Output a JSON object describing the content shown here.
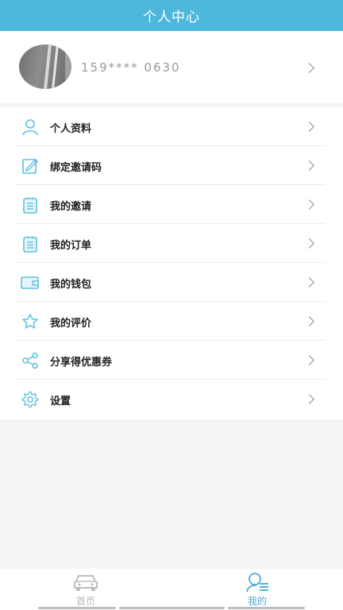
{
  "header": {
    "title": "个人中心"
  },
  "profile": {
    "phone": "159**** 0630"
  },
  "menu": {
    "items": [
      {
        "label": "个人资料",
        "icon": "user-icon"
      },
      {
        "label": "绑定邀请码",
        "icon": "edit-icon"
      },
      {
        "label": "我的邀请",
        "icon": "list-icon"
      },
      {
        "label": "我的订单",
        "icon": "list-icon"
      },
      {
        "label": "我的钱包",
        "icon": "wallet-icon"
      },
      {
        "label": "我的评价",
        "icon": "star-icon"
      },
      {
        "label": "分享得优惠券",
        "icon": "share-icon"
      },
      {
        "label": "设置",
        "icon": "gear-icon"
      }
    ]
  },
  "tabbar": {
    "home_label": "首页",
    "mine_label": "我的",
    "active": "mine"
  },
  "colors": {
    "accent": "#4db7dc",
    "icon": "#5bc0de",
    "active_tab": "#4aa9d6",
    "inactive_tab": "#b8b8b8"
  }
}
